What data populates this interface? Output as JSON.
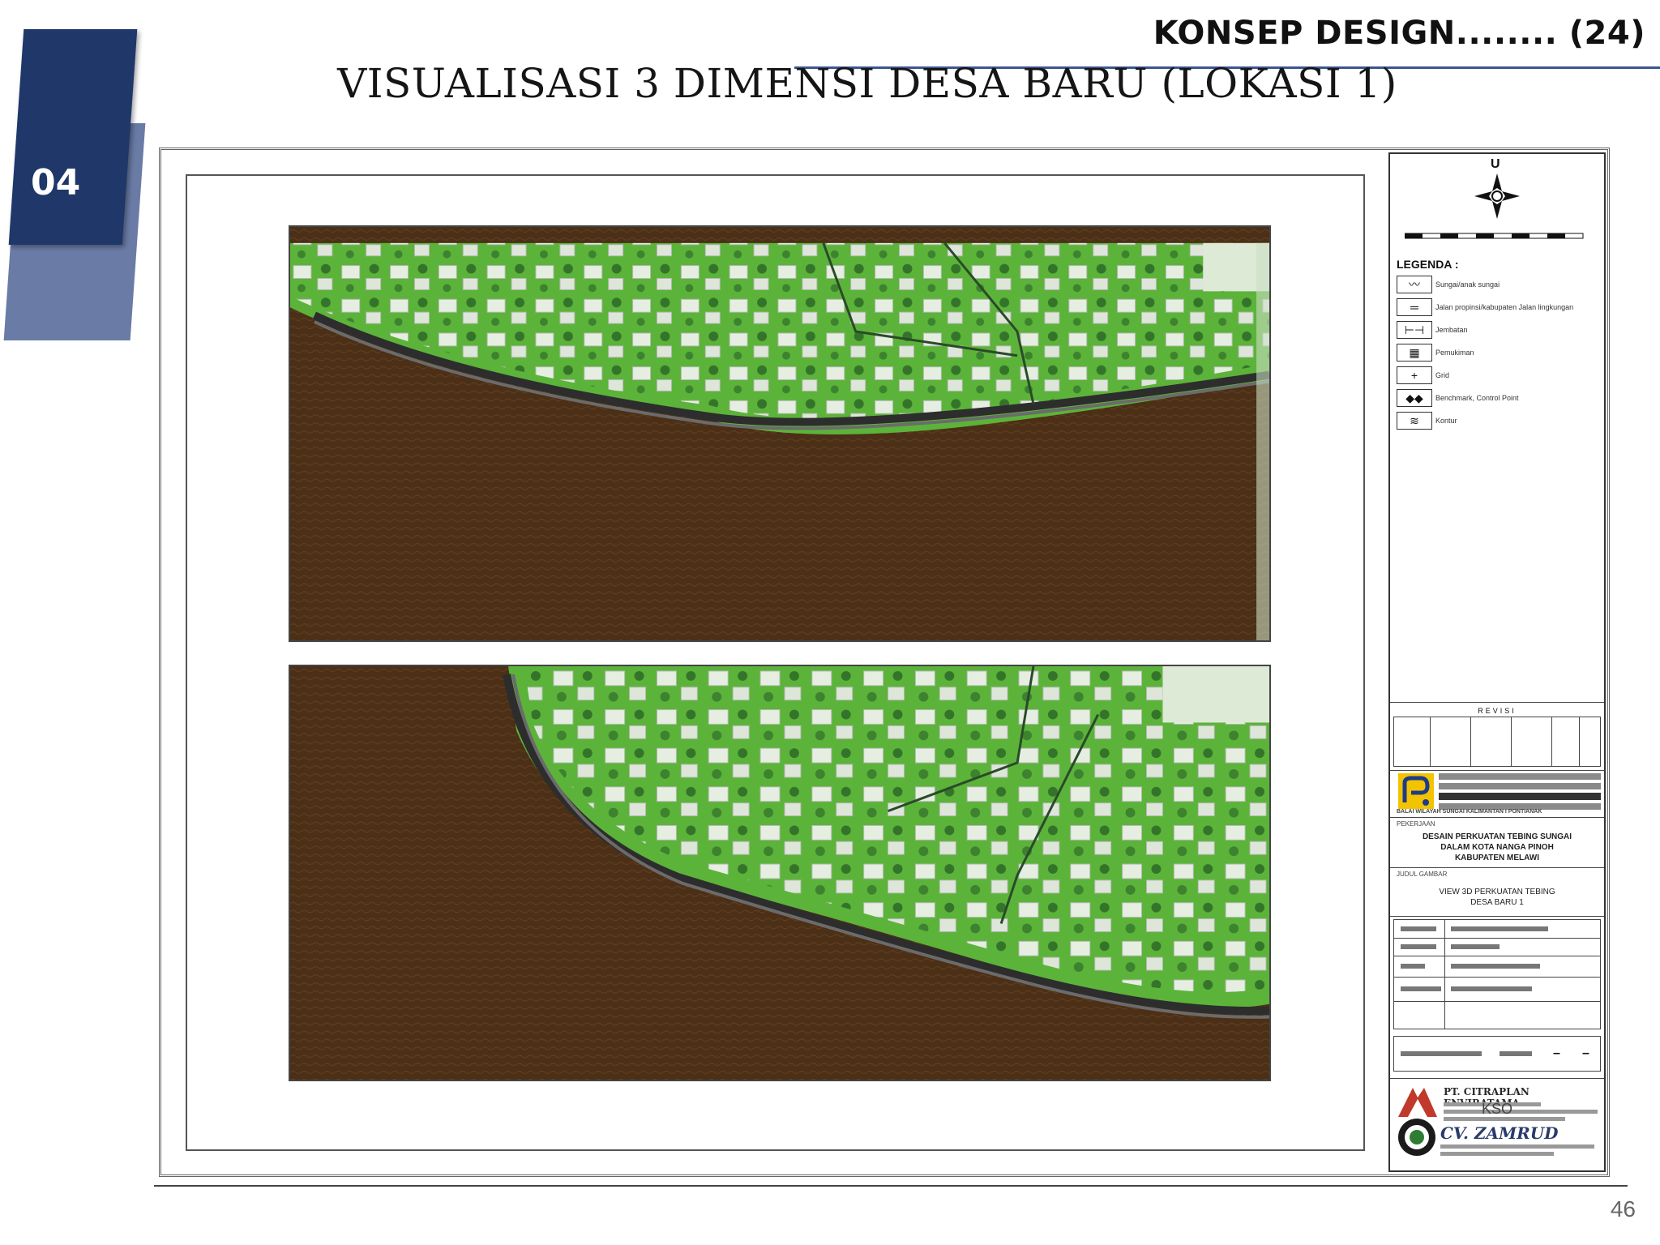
{
  "header": {
    "section_title": "KONSEP DESIGN........ (24)",
    "slide_title": "VISUALISASI 3 DIMENSI DESA BARU (LOKASI 1)"
  },
  "badge": {
    "number": "04"
  },
  "titleblock": {
    "north_letter": "U",
    "legend_heading": "LEGENDA :",
    "legend": [
      {
        "icon": "river-symbol",
        "label": "Sungai/anak sungai"
      },
      {
        "icon": "road-symbol",
        "label": "Jalan propinsi/kabupaten Jalan lingkungan"
      },
      {
        "icon": "bridge-symbol",
        "label": "Jembatan"
      },
      {
        "icon": "settlement-symbol",
        "label": "Pemukiman"
      },
      {
        "icon": "grid-symbol",
        "label": "Grid"
      },
      {
        "icon": "benchmark-symbol",
        "label": "Benchmark, Control Point"
      },
      {
        "icon": "contour-symbol",
        "label": "Kontur"
      }
    ],
    "revisi_label": "REVISI",
    "agency_name": "BALAI WILAYAH SUNGAI KALIMANTAN I PONTIANAK",
    "project_label": "PEKERJAAN",
    "project_title": [
      "DESAIN PERKUATAN TEBING SUNGAI",
      "DALAM KOTA NANGA PINOH",
      "KABUPATEN MELAWI"
    ],
    "drawing_label": "JUDUL GAMBAR",
    "drawing_title": [
      "VIEW 3D PERKUATAN TEBING",
      "DESA BARU 1"
    ],
    "company1": "PT. CITRAPLAN ENVIRATAMA",
    "kso": "KSO",
    "company2": "CV. ZAMRUD"
  },
  "colors": {
    "navy": "#1f3769",
    "slate": "#6a7ba6",
    "grass": "#5cb33a",
    "river": "#4a2f17"
  },
  "footer": {
    "page_number": "46"
  }
}
